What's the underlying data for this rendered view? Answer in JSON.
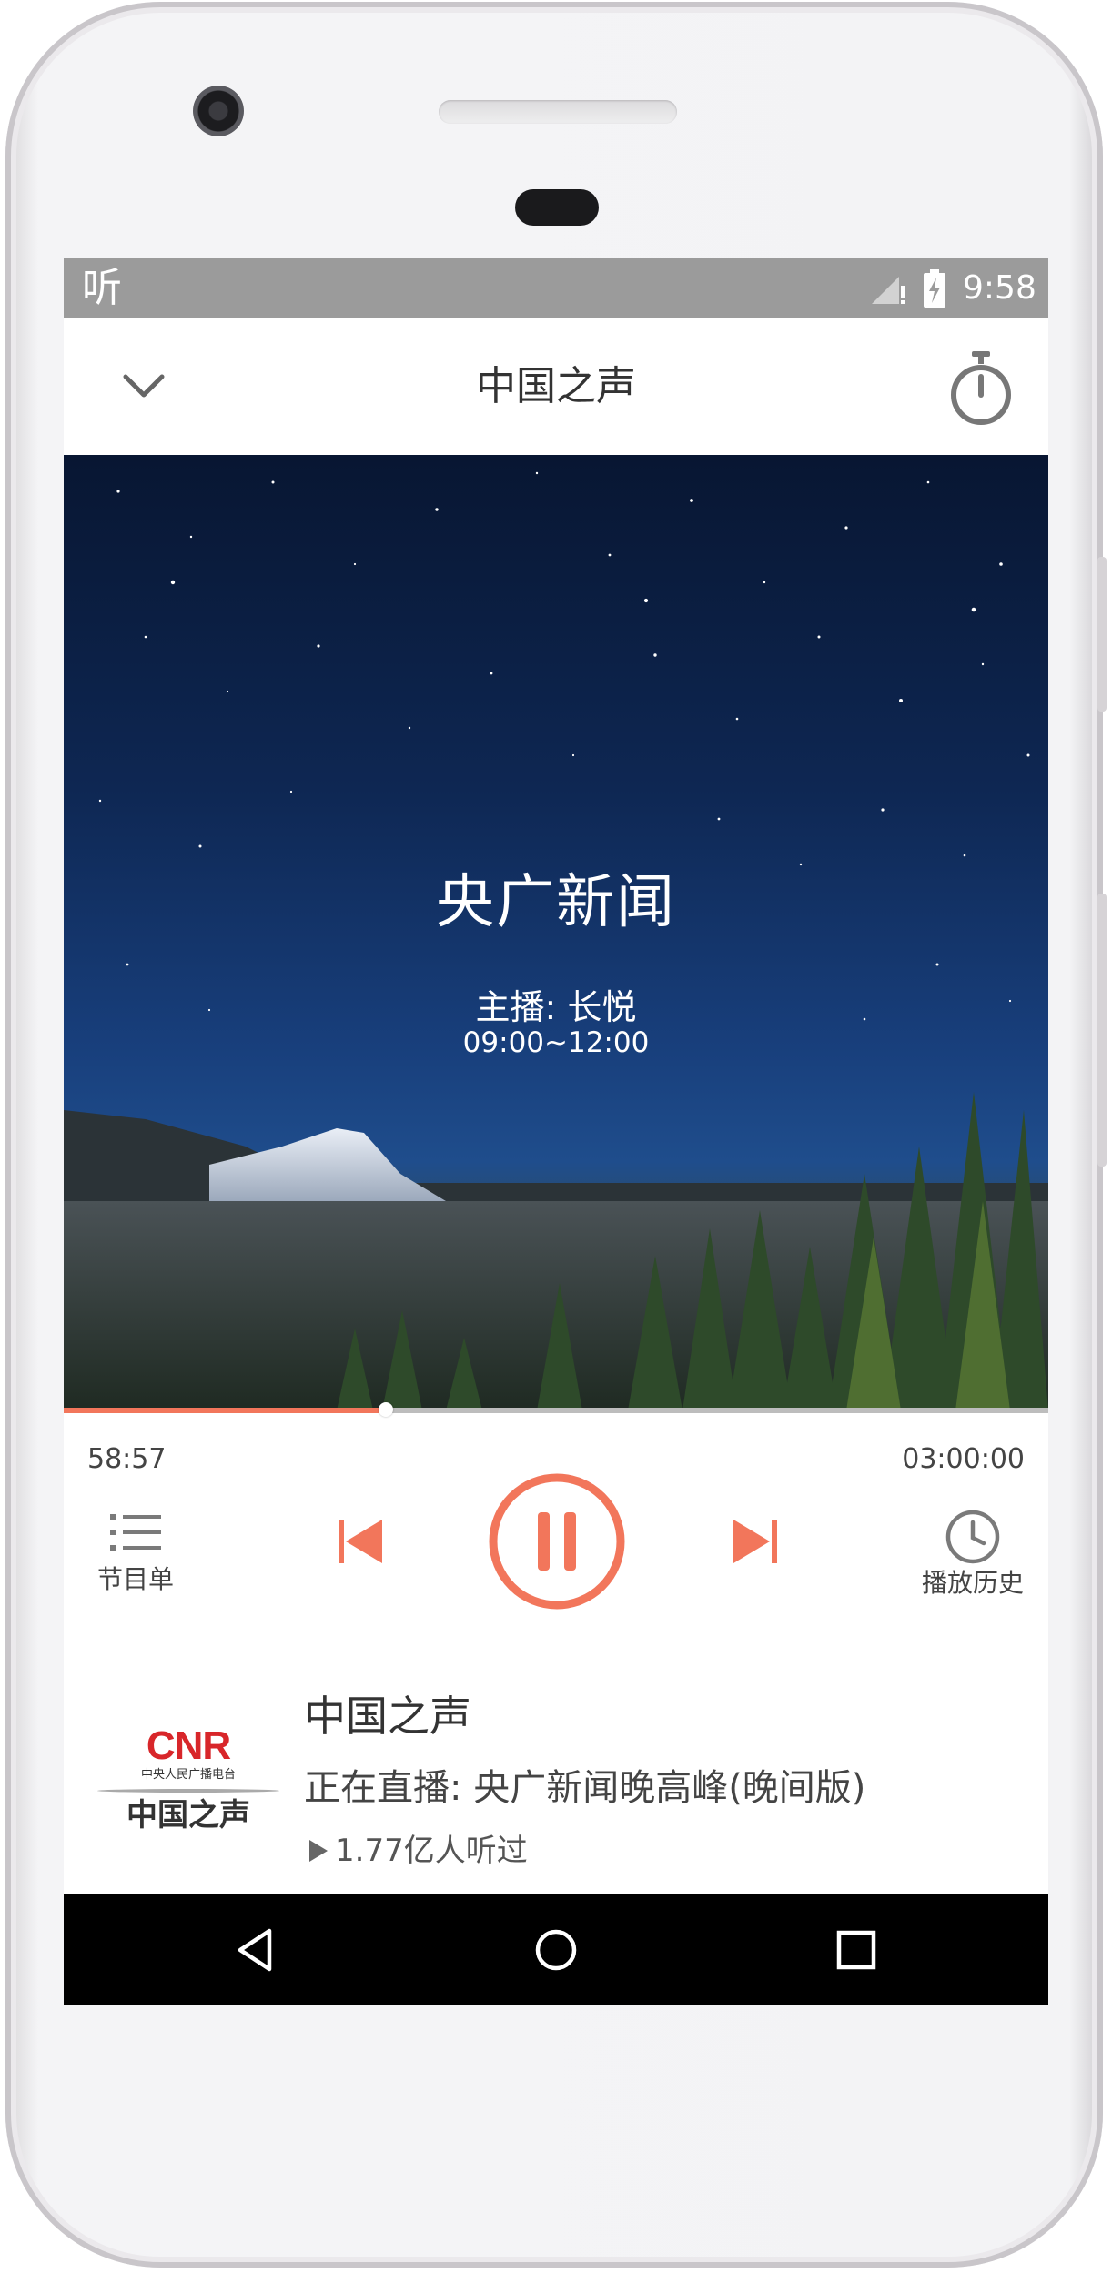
{
  "status_bar": {
    "app_icon_glyph": "听",
    "time": "9:58",
    "icons": [
      "signal-icon",
      "battery-charging-icon"
    ]
  },
  "app_bar": {
    "title": "中国之声",
    "back_icon": "chevron-down-icon",
    "timer_icon": "sleep-timer-icon"
  },
  "hero": {
    "program_title": "央广新闻",
    "host": "主播: 长悦",
    "schedule": "09:00~12:00"
  },
  "playback": {
    "elapsed": "58:57",
    "total": "03:00:00",
    "progress_fraction": 0.327
  },
  "controls": {
    "playlist_label": "节目单",
    "history_label": "播放历史",
    "accent_color": "#f2765b"
  },
  "station": {
    "logo_text": "CNR",
    "logo_subtext": "中央人民广播电台",
    "logo_name": "中国之声",
    "name": "中国之声",
    "live_text": "正在直播: 央广新闻晚高峰(晚间版)",
    "plays": "1.77亿人听过"
  }
}
